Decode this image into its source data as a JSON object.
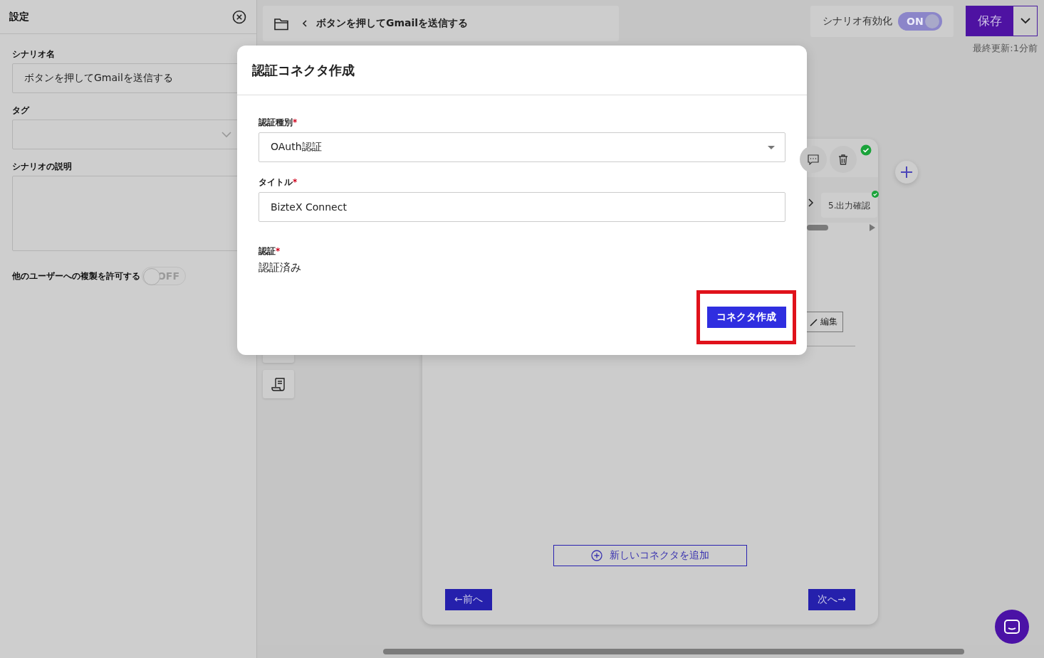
{
  "settings_panel": {
    "title": "設定",
    "fields": [
      {
        "label": "シナリオ名",
        "kind": "text",
        "value": "ボタンを押してGmailを送信する"
      },
      {
        "label": "タグ",
        "kind": "select"
      },
      {
        "label": "シナリオの説明",
        "kind": "textarea"
      }
    ],
    "copy_toggle": {
      "label": "他のユーザーへの複製を許可する",
      "on": false,
      "state_text": "OFF"
    }
  },
  "breadcrumb": {
    "title": "ボタンを押してGmailを送信する"
  },
  "scenario_toggle": {
    "label": "シナリオ有効化",
    "on": true,
    "state_text": "ON"
  },
  "save_button": "保存",
  "last_updated": "最終更新:1分前",
  "canvas": {
    "step_chip": {
      "label": "5.出力確認",
      "done": true
    },
    "edit_button": "編集",
    "add_connector_button": "新しいコネクタを追加",
    "prev_button": "←前へ",
    "next_button": "次へ→"
  },
  "dialog": {
    "title": "認証コネクタ作成",
    "fields": [
      {
        "label": "認証種別",
        "required_mark": "*",
        "kind": "select",
        "value": "OAuth認証"
      },
      {
        "label": "タイトル",
        "required_mark": "*",
        "kind": "text",
        "value": "BizteX Connect"
      },
      {
        "label": "認証",
        "required_mark": "*",
        "kind": "static",
        "value": "認証済み"
      }
    ],
    "submit_button": "コネクタ作成",
    "highlighted": true
  }
}
